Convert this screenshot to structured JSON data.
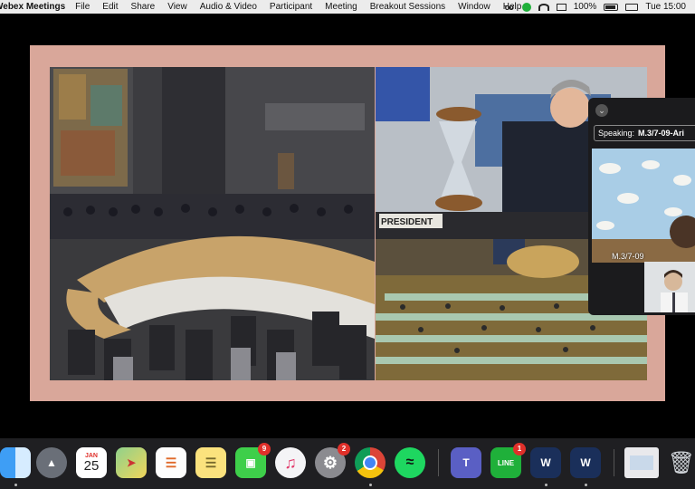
{
  "menubar": {
    "app_name": "Webex Meetings",
    "items": [
      "File",
      "Edit",
      "Share",
      "View",
      "Audio & Video",
      "Participant",
      "Meeting",
      "Breakout Sessions",
      "Window",
      "Help"
    ],
    "battery": "100%",
    "clock": "Tue 15:00"
  },
  "panel": {
    "speaking_label": "Speaking:",
    "speaking_name": "M.3/7-09-Ari",
    "video_name": "M.3/7-09"
  },
  "photo_right": {
    "placard": "PRESIDENT"
  },
  "dock": {
    "calendar_month": "JAN",
    "calendar_day": "25",
    "facetime_badge": "9",
    "prefs_badge": "2",
    "line_badge": "1",
    "line_label": "LINE"
  },
  "colors": {
    "frame": "#d9a79a",
    "menubar": "#ececec",
    "badge": "#e0302a"
  }
}
